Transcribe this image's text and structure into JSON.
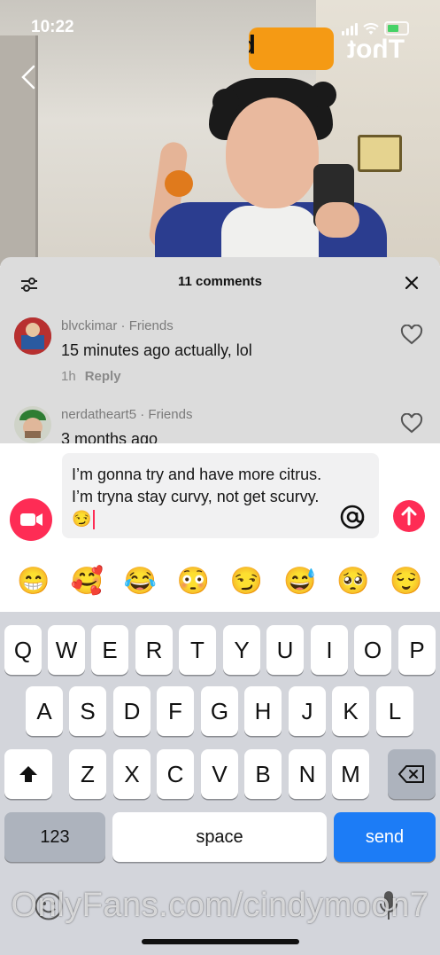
{
  "status_bar": {
    "time": "10:22"
  },
  "watermark_top": "Thot porn",
  "comments": {
    "count_label": "11 comments",
    "items": [
      {
        "username": "blvckimar",
        "relation": "Friends",
        "text": "15 minutes ago actually, lol",
        "age": "1h",
        "reply_label": "Reply"
      },
      {
        "username": "nerdatheart5",
        "relation": "Friends",
        "text": "3 months ago",
        "age": "",
        "reply_label": ""
      }
    ]
  },
  "composer": {
    "text": "I’m gonna try and have more citrus. I’m tryna stay curvy, not get scurvy. 😏",
    "emojis": [
      "😁",
      "🥰",
      "😂",
      "😳",
      "😏",
      "😅",
      "🥺",
      "😌"
    ]
  },
  "keyboard": {
    "row1": [
      "Q",
      "W",
      "E",
      "R",
      "T",
      "Y",
      "U",
      "I",
      "O",
      "P"
    ],
    "row2": [
      "A",
      "S",
      "D",
      "F",
      "G",
      "H",
      "J",
      "K",
      "L"
    ],
    "row3": [
      "Z",
      "X",
      "C",
      "V",
      "B",
      "N",
      "M"
    ],
    "numbers_label": "123",
    "space_label": "space",
    "send_label": "send"
  },
  "bottom_watermark": "OnlyFans.com/cindymoon7",
  "colors": {
    "accent": "#fe2c55",
    "send_key": "#1c7cf6",
    "sheet_bg": "#dcdcdc"
  }
}
